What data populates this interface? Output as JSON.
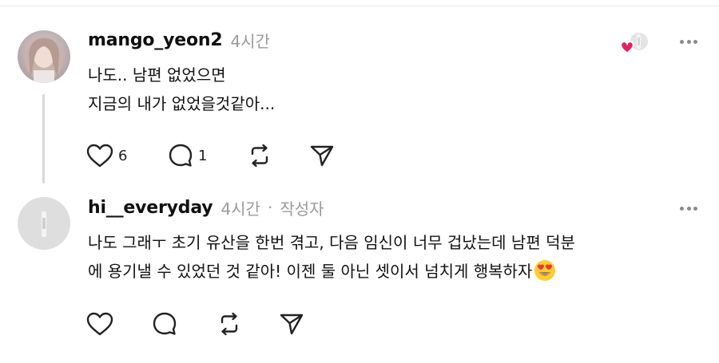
{
  "colors": {
    "divider": "#e6e6e6",
    "muted_text": "#9a9a9a",
    "thread_line": "#d9d9d9",
    "heart_red": "#e0245e",
    "icon": "#222222"
  },
  "comments": [
    {
      "username": "mango_yeon2",
      "time": "4시간",
      "lines": [
        "나도.. 남편 없었으면",
        "지금의 내가 없었을것같아..."
      ],
      "likes": "6",
      "replies": "1",
      "liked_by_author": true,
      "icons": [
        "heart-icon",
        "comment-icon",
        "repost-icon",
        "send-icon",
        "more-icon"
      ]
    },
    {
      "username": "hi__everyday",
      "time": "4시간",
      "author_separator": "·",
      "author_tag": "작성자",
      "lines": [
        "나도 그래ㅜ 초기 유산을 한번 겪고, 다음 임신이 너무 겁났는데 남편 덕분",
        "에 용기낼 수 있었던 것 같아! 이젠 둘 아닌 셋이서 넘치게 행복하자"
      ],
      "trailing_emoji": "heart-eyes-emoji",
      "icons": [
        "heart-icon",
        "comment-icon",
        "repost-icon",
        "send-icon",
        "more-icon"
      ]
    }
  ]
}
